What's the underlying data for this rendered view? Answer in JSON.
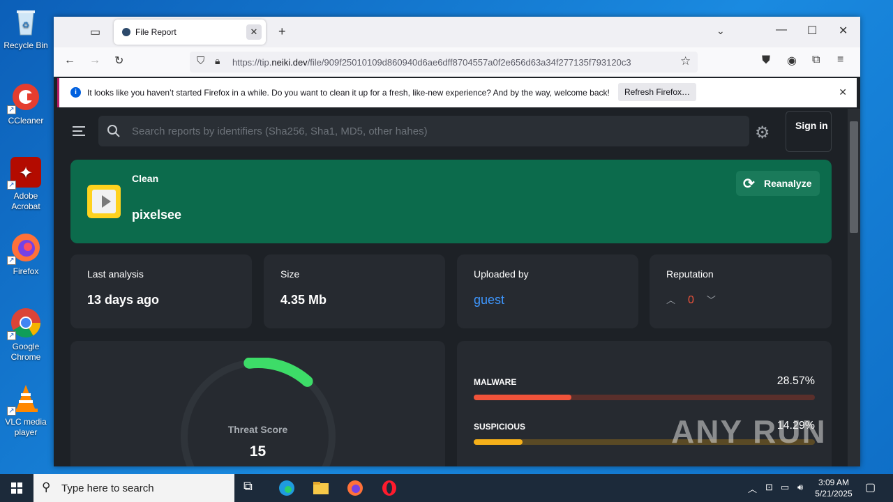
{
  "desktop": {
    "icons": [
      {
        "label": "Recycle Bin"
      },
      {
        "label": "CCleaner"
      },
      {
        "label": "Adobe Acrobat"
      },
      {
        "label": "Firefox"
      },
      {
        "label": "Google Chrome"
      },
      {
        "label": "VLC media player"
      }
    ]
  },
  "browser": {
    "tab_title": "File Report",
    "url_prefix": "https://tip.",
    "url_domain": "neiki.dev",
    "url_path": "/file/909f25010109d860940d6ae6dff8704557a0f2e656d63a34f277135f793120c3",
    "notification": "It looks like you haven’t started Firefox in a while. Do you want to clean it up for a fresh, like-new experience? And by the way, welcome back!",
    "refresh_button": "Refresh Firefox…"
  },
  "page": {
    "search_placeholder": "Search reports by identifiers (Sha256, Sha1, MD5, other hahes)",
    "signin": "Sign in",
    "banner": {
      "status": "Clean",
      "name": "pixelsee",
      "reanalyze": "Reanalyze",
      "color": "#0c6b4c"
    },
    "cards": {
      "last_analysis_label": "Last analysis",
      "last_analysis_value": "13 days ago",
      "size_label": "Size",
      "size_value": "4.35 Mb",
      "uploaded_label": "Uploaded by",
      "uploaded_value": "guest",
      "reputation_label": "Reputation",
      "reputation_value": "0"
    },
    "threat": {
      "label": "Threat Score",
      "value": "15"
    },
    "detections": [
      {
        "label": "MALWARE",
        "percent": "28.57%",
        "fraction": 0.2857,
        "color": "#f0533a",
        "track": "#5a2f2b"
      },
      {
        "label": "SUSPICIOUS",
        "percent": "14.29%",
        "fraction": 0.1429,
        "color": "#f5b01a",
        "track": "#5a4a25"
      }
    ],
    "watermark": "ANY RUN"
  },
  "taskbar": {
    "search_text": "Type here to search",
    "time": "3:09 AM",
    "date": "5/21/2025"
  }
}
